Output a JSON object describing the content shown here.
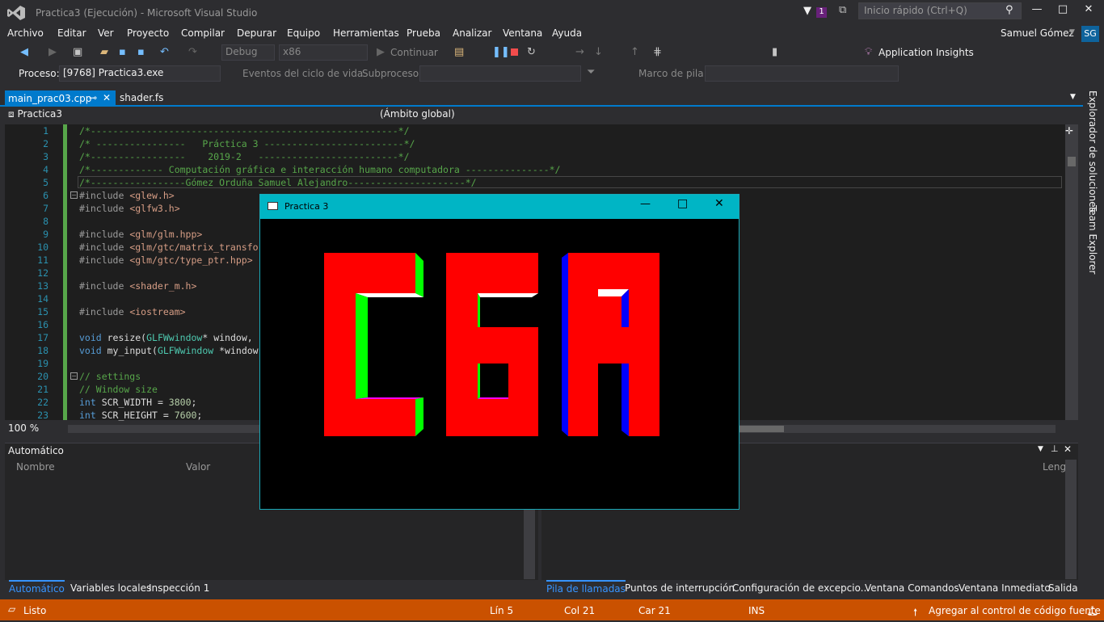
{
  "window": {
    "title": "Practica3 (Ejecución) - Microsoft Visual Studio",
    "quick_launch": "Inicio rápido (Ctrl+Q)",
    "notification_count": "1",
    "minimize": "—",
    "maximize": "□",
    "close": "✕"
  },
  "menu": [
    "Archivo",
    "Editar",
    "Ver",
    "Proyecto",
    "Compilar",
    "Depurar",
    "Equipo",
    "Herramientas",
    "Prueba",
    "Analizar",
    "Ventana",
    "Ayuda"
  ],
  "user": {
    "name": "Samuel Gómez",
    "initials": "SG"
  },
  "toolbar": {
    "config": "Debug",
    "platform": "x86",
    "continue": "Continuar",
    "app_insights": "Application Insights"
  },
  "debugbar": {
    "process_label": "Proceso:",
    "process_value": "[9768] Practica3.exe",
    "lifecycle": "Eventos del ciclo de vida",
    "thread_label": "Subproceso:",
    "stack_label": "Marco de pila:"
  },
  "tabs": [
    {
      "label": "main_prac03.cpp",
      "active": true
    },
    {
      "label": "shader.fs",
      "active": false
    }
  ],
  "navbar": {
    "project": "Practica3",
    "scope": "(Ámbito global)"
  },
  "code_lines": [
    {
      "n": "1",
      "t": "/*-------------------------------------------------------*/",
      "c": "cm"
    },
    {
      "n": "2",
      "t": "/* ----------------   Práctica 3 -------------------------*/",
      "c": "cm"
    },
    {
      "n": "3",
      "t": "/*-----------------    2019-2   -------------------------*/",
      "c": "cm"
    },
    {
      "n": "4",
      "t": "/*------------- Computación gráfica e interacción humano computadora ---------------*/",
      "c": "cm"
    },
    {
      "n": "5",
      "t": "/*-----------------Gómez Orduña Samuel Alejandro---------------------*/",
      "c": "cm"
    },
    {
      "n": "6",
      "t": "#include <glew.h>",
      "c": "inc"
    },
    {
      "n": "7",
      "t": "#include <glfw3.h>",
      "c": "inc"
    },
    {
      "n": "8",
      "t": "",
      "c": "txt"
    },
    {
      "n": "9",
      "t": "#include <glm/glm.hpp>",
      "c": "inc"
    },
    {
      "n": "10",
      "t": "#include <glm/gtc/matrix_transfo",
      "c": "inc"
    },
    {
      "n": "11",
      "t": "#include <glm/gtc/type_ptr.hpp>",
      "c": "inc"
    },
    {
      "n": "12",
      "t": "",
      "c": "txt"
    },
    {
      "n": "13",
      "t": "#include <shader_m.h>",
      "c": "inc"
    },
    {
      "n": "14",
      "t": "",
      "c": "txt"
    },
    {
      "n": "15",
      "t": "#include <iostream>",
      "c": "inc"
    },
    {
      "n": "16",
      "t": "",
      "c": "txt"
    },
    {
      "n": "17",
      "t": "void resize(GLFWwindow* window,",
      "c": "fn"
    },
    {
      "n": "18",
      "t": "void my_input(GLFWwindow *window",
      "c": "fn"
    },
    {
      "n": "19",
      "t": "",
      "c": "txt"
    },
    {
      "n": "20",
      "t": "// settings",
      "c": "cm"
    },
    {
      "n": "21",
      "t": "// Window size",
      "c": "cm"
    },
    {
      "n": "22",
      "t": "int SCR_WIDTH = 3800;",
      "c": "int"
    },
    {
      "n": "23",
      "t": "int SCR_HEIGHT = 7600;",
      "c": "int"
    }
  ],
  "zoom": "100 %",
  "auto_pane": {
    "title": "Automático",
    "col1": "Nombre",
    "col2": "Valor"
  },
  "call_pane": {
    "col3": "Leng"
  },
  "bottom_tabs_left": [
    "Automático",
    "Variables locales",
    "Inspección 1"
  ],
  "bottom_tabs_right": [
    "Pila de llamadas",
    "Puntos de interrupción",
    "Configuración de excepcio...",
    "Ventana Comandos",
    "Ventana Inmediato",
    "Salida"
  ],
  "right_panel": [
    "Explorador de soluciones",
    "Team Explorer"
  ],
  "status": {
    "state": "Listo",
    "line": "Lín 5",
    "col": "Col 21",
    "car": "Car 21",
    "mode": "INS",
    "source_control": "Agregar al control de código fuente"
  },
  "gl_window": {
    "title": "Practica 3"
  },
  "colors": {
    "accent": "#007acc",
    "status": "#ca5100",
    "gl_title": "#00b5c5",
    "red": "#ff0000",
    "green": "#00ff00",
    "blue": "#0000ff",
    "magenta": "#ff00ff"
  }
}
